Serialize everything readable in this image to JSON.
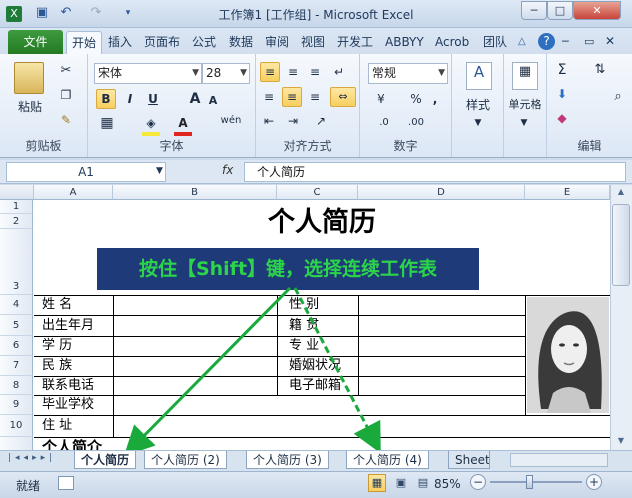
{
  "window": {
    "title": "工作簿1 [工作组] - Microsoft Excel",
    "min": "─",
    "max": "□",
    "close": "✕"
  },
  "quick_access": {
    "save_icon": "save-icon",
    "undo_icon": "undo-icon",
    "redo_icon": "redo-icon"
  },
  "tabs": {
    "file": "文件",
    "items": [
      "开始",
      "插入",
      "页面布",
      "公式",
      "数据",
      "审阅",
      "视图",
      "开发工",
      "ABBYY",
      "Acrob",
      "团队"
    ]
  },
  "ribbon": {
    "clipboard": {
      "label": "剪贴板",
      "paste": "粘贴"
    },
    "font": {
      "label": "字体",
      "name": "宋体",
      "size": "28",
      "bold": "B",
      "italic": "I",
      "underline": "U",
      "grow": "A",
      "shrink": "A",
      "wen": "wén"
    },
    "align": {
      "label": "对齐方式"
    },
    "number": {
      "label": "数字",
      "format": "常规",
      "percent": "%",
      "comma": ",",
      "inc": ".0",
      "dec": ".00"
    },
    "styles": {
      "label": "样式"
    },
    "cells": {
      "label": "单元格"
    },
    "editing": {
      "label": "编辑",
      "sigma": "Σ"
    }
  },
  "formula_bar": {
    "name_box": "A1",
    "fx": "fx",
    "value": "个人简历"
  },
  "columns": [
    "A",
    "B",
    "C",
    "D",
    "E"
  ],
  "rows": [
    "1",
    "2",
    "3",
    "4",
    "5",
    "6",
    "7",
    "8",
    "9",
    "10"
  ],
  "sheet": {
    "title": "个人简历",
    "banner": "按住【Shift】键，选择连续工作表",
    "labels_left": [
      "姓    名",
      "出生年月",
      "学    历",
      "民    族",
      "联系电话",
      "毕业学校",
      "住    址"
    ],
    "labels_mid": [
      "性    别",
      "籍    贯",
      "专    业",
      "婚姻状况",
      "电子邮箱"
    ],
    "row11_text": "个人简介"
  },
  "sheet_tabs": [
    "个人简历",
    "个人简历 (2)",
    "个人简历 (3)",
    "个人简历 (4)",
    "Sheet"
  ],
  "status": {
    "ready": "就绪",
    "zoom": "85%",
    "zoom_out": "−",
    "zoom_in": "+"
  },
  "colors": {
    "banner_bg": "#1f3a78",
    "banner_text": "#2bd44a",
    "arrow": "#1aaa3c",
    "file_tab": "#2a802a"
  }
}
